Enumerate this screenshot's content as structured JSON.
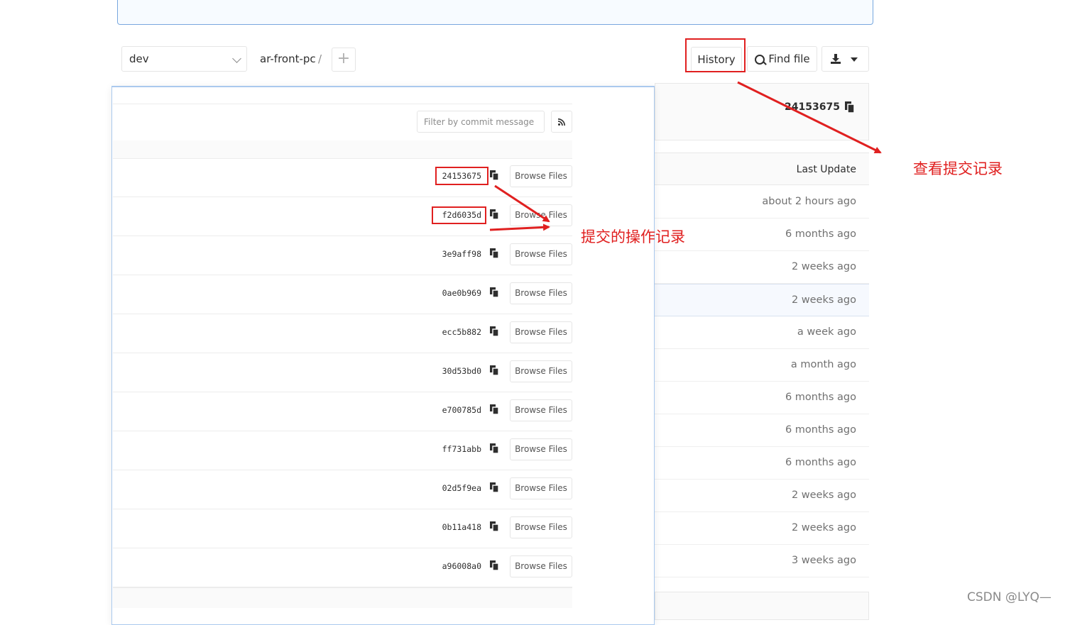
{
  "toolbar": {
    "branch": "dev",
    "path": "ar-front-pc",
    "path_separator": "/",
    "add_symbol": "+",
    "history_label": "History",
    "find_file_label": "Find file"
  },
  "last_commit": {
    "sha": "24153675"
  },
  "file_table": {
    "header": "Last Update",
    "updates": [
      "about 2 hours ago",
      "6 months ago",
      "2 weeks ago",
      "2 weeks ago",
      "a week ago",
      "a month ago",
      "6 months ago",
      "6 months ago",
      "6 months ago",
      "2 weeks ago",
      "2 weeks ago",
      "3 weeks ago"
    ]
  },
  "commits_popup": {
    "filter_placeholder": "Filter by commit message",
    "browse_label": "Browse Files",
    "commits": [
      "24153675",
      "f2d6035d",
      "3e9aff98",
      "0ae0b969",
      "ecc5b882",
      "30d53bd0",
      "e700785d",
      "ff731abb",
      "02d5f9ea",
      "0b11a418",
      "a96008a0"
    ]
  },
  "annotations": {
    "history_note": "查看提交记录",
    "commits_note": "提交的操作记录",
    "color": "#e02020"
  },
  "watermark": "CSDN @LYQ—"
}
